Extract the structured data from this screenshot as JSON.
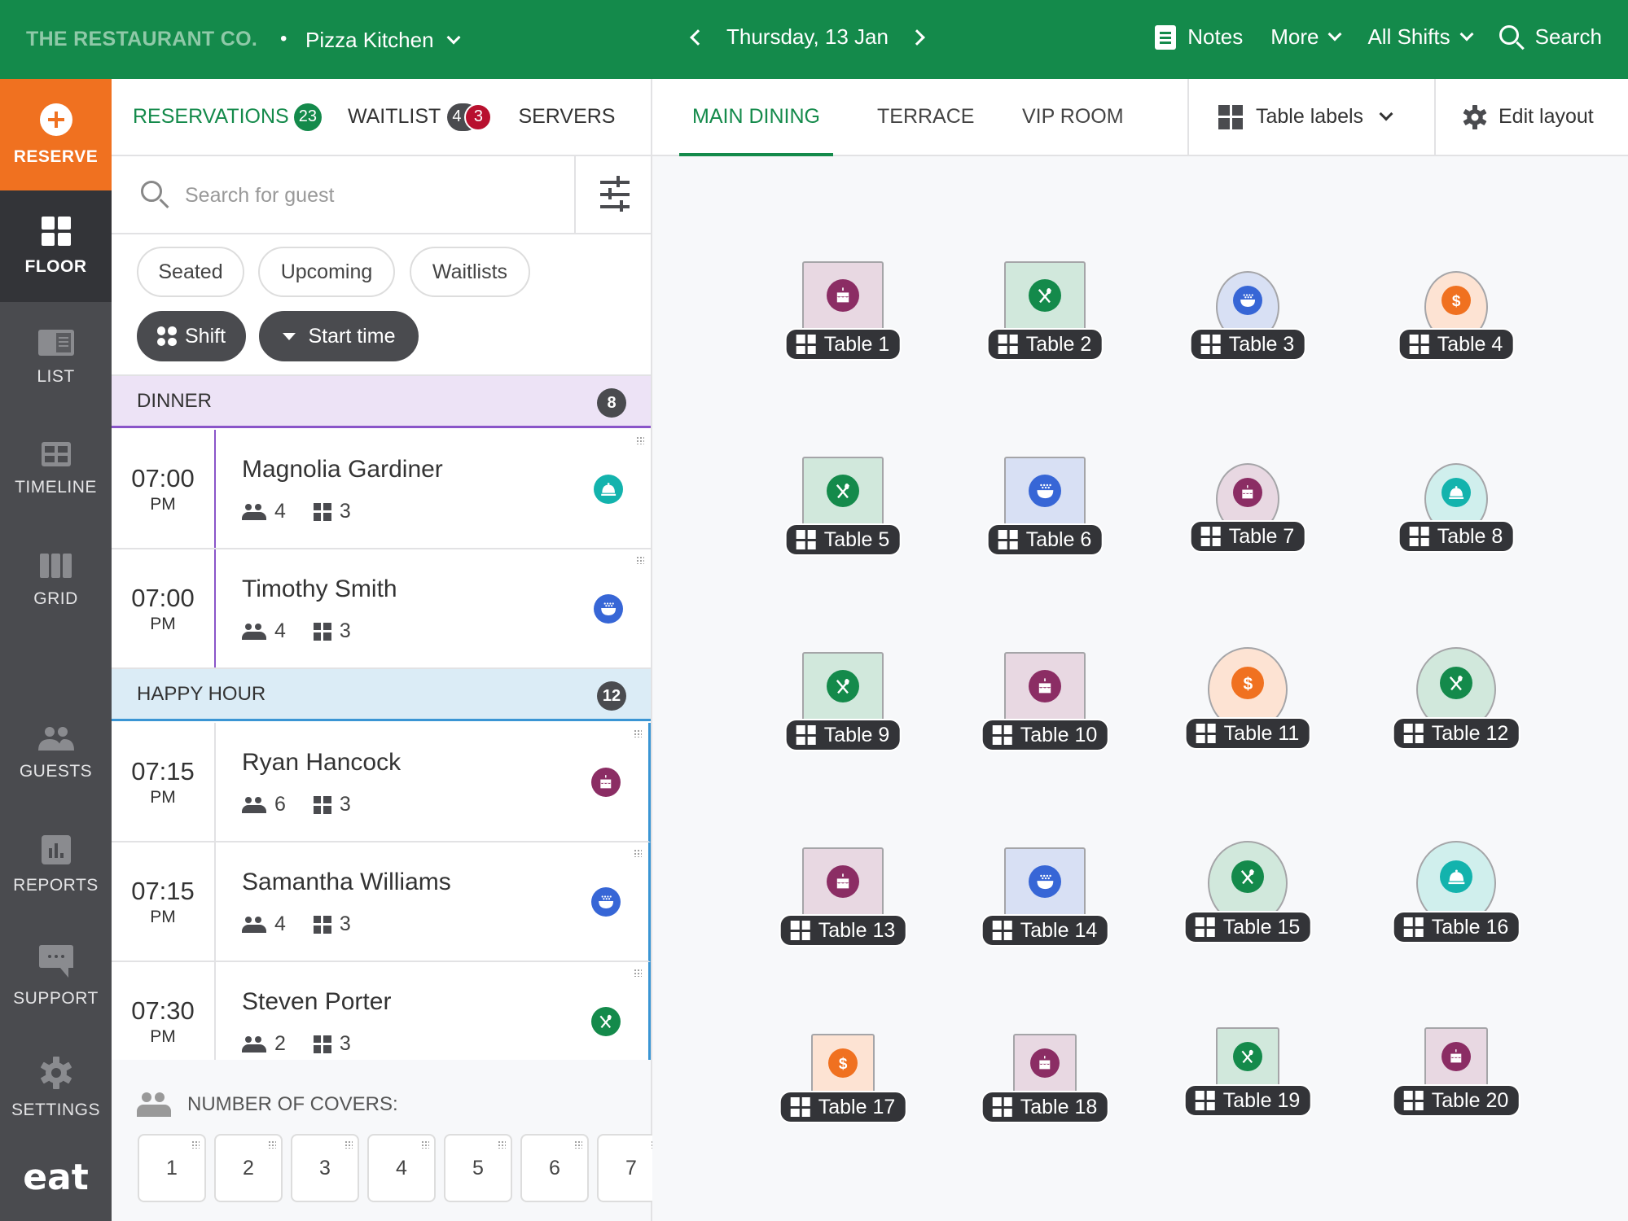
{
  "topbar": {
    "brand": "THE RESTAURANT CO.",
    "venue": "Pizza Kitchen",
    "date": "Thursday, 13 Jan",
    "notes": "Notes",
    "more": "More",
    "shifts": "All Shifts",
    "search": "Search"
  },
  "sidebar": {
    "reserve": "RESERVE",
    "items": [
      {
        "label": "FLOOR",
        "icon": "floor-grid-icon",
        "active": true
      },
      {
        "label": "LIST",
        "icon": "list-icon"
      },
      {
        "label": "TIMELINE",
        "icon": "timeline-icon"
      },
      {
        "label": "GRID",
        "icon": "grid-columns-icon"
      },
      {
        "label": "GUESTS",
        "icon": "guests-icon"
      },
      {
        "label": "REPORTS",
        "icon": "reports-icon"
      },
      {
        "label": "SUPPORT",
        "icon": "support-chat-icon"
      },
      {
        "label": "SETTINGS",
        "icon": "gear-icon"
      }
    ],
    "logo": "eat"
  },
  "left_tabs": {
    "reservations": {
      "label": "RESERVATIONS",
      "count": "23"
    },
    "waitlist": {
      "label": "WAITLIST",
      "count": "4",
      "alert": "3"
    },
    "servers": {
      "label": "SERVERS"
    }
  },
  "search": {
    "placeholder": "Search for guest",
    "value": ""
  },
  "filters": {
    "chips": [
      "Seated",
      "Upcoming",
      "Waitlists"
    ],
    "group_by": "Shift",
    "sort_by": "Start time"
  },
  "sections": [
    {
      "name": "DINNER",
      "count": "8",
      "color": "#8a55c9",
      "bg": "#ede3f6",
      "reservations": [
        {
          "time": "07:00",
          "ampm": "PM",
          "name": "Magnolia Gardiner",
          "covers": "4",
          "table": "3",
          "status": "served"
        },
        {
          "time": "07:00",
          "ampm": "PM",
          "name": "Timothy Smith",
          "covers": "4",
          "table": "3",
          "status": "main-course"
        }
      ]
    },
    {
      "name": "HAPPY HOUR",
      "count": "12",
      "color": "#3a95d4",
      "bg": "#dbecf6",
      "reservations": [
        {
          "time": "07:15",
          "ampm": "PM",
          "name": "Ryan Hancock",
          "covers": "6",
          "table": "3",
          "status": "dessert"
        },
        {
          "time": "07:15",
          "ampm": "PM",
          "name": "Samantha Williams",
          "covers": "4",
          "table": "3",
          "status": "main-course"
        },
        {
          "time": "07:30",
          "ampm": "PM",
          "name": "Steven Porter",
          "covers": "2",
          "table": "3",
          "status": "seated"
        }
      ]
    }
  ],
  "covers": {
    "label": "NUMBER OF COVERS:",
    "options": [
      "1",
      "2",
      "3",
      "4",
      "5",
      "6",
      "7"
    ]
  },
  "rooms": {
    "tabs": [
      "MAIN DINING",
      "TERRACE",
      "VIP ROOM"
    ],
    "active": "MAIN DINING",
    "table_labels": "Table labels",
    "edit_layout": "Edit layout"
  },
  "status_colors": {
    "dessert": {
      "fg": "#8b2d64",
      "bg": "#e8d8e2"
    },
    "seated": {
      "fg": "#148a4b",
      "bg": "#d1e8dc"
    },
    "main-course": {
      "fg": "#3766d6",
      "bg": "#d8e0f4"
    },
    "bill": {
      "fg": "#f07120",
      "bg": "#fde3d3"
    },
    "served": {
      "fg": "#13b3ad",
      "bg": "#d0efed"
    }
  },
  "tables": [
    {
      "label": "Table 1",
      "shape": "rect",
      "status": "dessert"
    },
    {
      "label": "Table 2",
      "shape": "rect",
      "status": "seated"
    },
    {
      "label": "Table 3",
      "shape": "round-sm",
      "status": "main-course"
    },
    {
      "label": "Table 4",
      "shape": "round-sm",
      "status": "bill"
    },
    {
      "label": "Table 5",
      "shape": "rect",
      "status": "seated"
    },
    {
      "label": "Table 6",
      "shape": "rect",
      "status": "main-course"
    },
    {
      "label": "Table 7",
      "shape": "round-sm",
      "status": "dessert"
    },
    {
      "label": "Table 8",
      "shape": "round-sm",
      "status": "served"
    },
    {
      "label": "Table 9",
      "shape": "rect",
      "status": "seated"
    },
    {
      "label": "Table 10",
      "shape": "rect",
      "status": "dessert"
    },
    {
      "label": "Table 11",
      "shape": "round-lg",
      "status": "bill"
    },
    {
      "label": "Table 12",
      "shape": "round-lg",
      "status": "seated"
    },
    {
      "label": "Table 13",
      "shape": "rect",
      "status": "dessert"
    },
    {
      "label": "Table 14",
      "shape": "rect",
      "status": "main-course"
    },
    {
      "label": "Table 15",
      "shape": "round-lg",
      "status": "seated"
    },
    {
      "label": "Table 16",
      "shape": "round-lg",
      "status": "served"
    },
    {
      "label": "Table 17",
      "shape": "rect-sm",
      "status": "bill"
    },
    {
      "label": "Table 18",
      "shape": "rect-sm",
      "status": "dessert"
    },
    {
      "label": "Table 19",
      "shape": "rect-sm",
      "status": "seated"
    },
    {
      "label": "Table 20",
      "shape": "rect-sm",
      "status": "dessert"
    }
  ]
}
